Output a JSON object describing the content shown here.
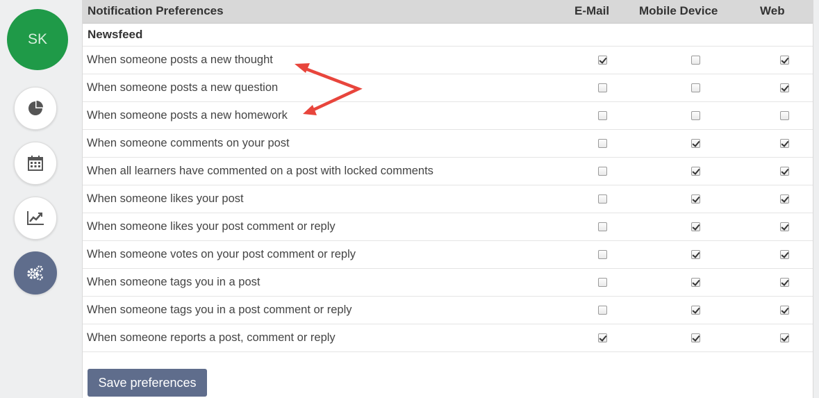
{
  "user": {
    "initials": "SK"
  },
  "sidebar": {
    "items": [
      {
        "icon": "pie-chart-icon"
      },
      {
        "icon": "calendar-icon"
      },
      {
        "icon": "line-chart-icon"
      },
      {
        "icon": "gears-icon",
        "active": true
      }
    ]
  },
  "table": {
    "title": "Notification Preferences",
    "columns": [
      "E-Mail",
      "Mobile Device",
      "Web"
    ],
    "section": "Newsfeed",
    "rows": [
      {
        "label": "When someone posts a new thought",
        "email": true,
        "mobile": false,
        "web": true
      },
      {
        "label": "When someone posts a new question",
        "email": false,
        "mobile": false,
        "web": true
      },
      {
        "label": "When someone posts a new homework",
        "email": false,
        "mobile": false,
        "web": false
      },
      {
        "label": "When someone comments on your post",
        "email": false,
        "mobile": true,
        "web": true
      },
      {
        "label": "When all learners have commented on a post with locked comments",
        "email": false,
        "mobile": true,
        "web": true
      },
      {
        "label": "When someone likes your post",
        "email": false,
        "mobile": true,
        "web": true
      },
      {
        "label": "When someone likes your post comment or reply",
        "email": false,
        "mobile": true,
        "web": true
      },
      {
        "label": "When someone votes on your post comment or reply",
        "email": false,
        "mobile": true,
        "web": true
      },
      {
        "label": "When someone tags you in a post",
        "email": false,
        "mobile": true,
        "web": true
      },
      {
        "label": "When someone tags you in a post comment or reply",
        "email": false,
        "mobile": true,
        "web": true
      },
      {
        "label": "When someone reports a post, comment or reply",
        "email": true,
        "mobile": true,
        "web": true
      }
    ]
  },
  "actions": {
    "save_label": "Save preferences"
  },
  "colors": {
    "accent": "#5f6d8c",
    "avatar": "#1f9a48",
    "annotation_arrow": "#e8453c"
  }
}
